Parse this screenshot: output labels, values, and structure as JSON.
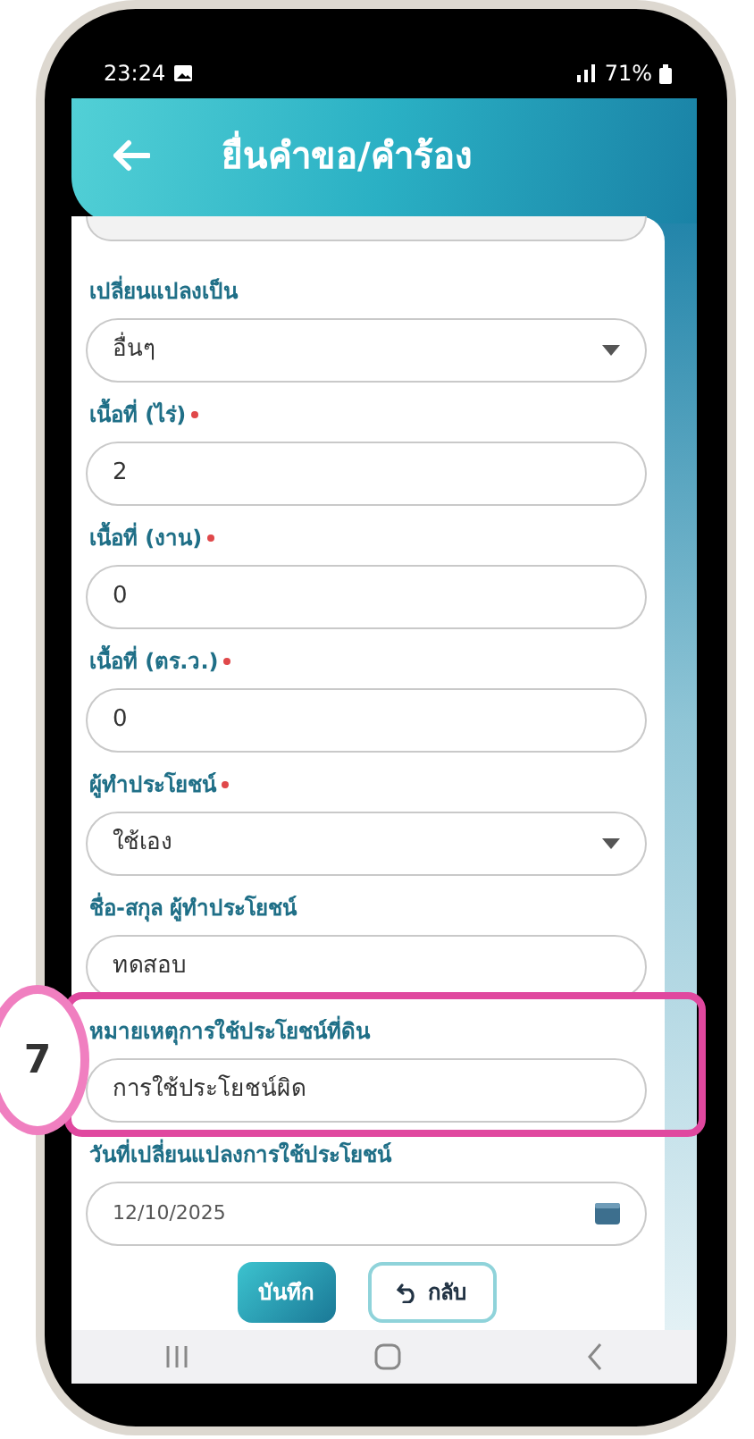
{
  "status_bar": {
    "time": "23:24",
    "battery": "71%"
  },
  "header": {
    "title": "ยื่นคำขอ/คำร้อง"
  },
  "fields": [
    {
      "kind": "select",
      "label": "เปลี่ยนแปลงเป็น",
      "required": false,
      "highlighted": false,
      "value": "อื่นๆ"
    },
    {
      "kind": "text",
      "label": "เนื้อที่ (ไร่)",
      "required": true,
      "highlighted": false,
      "value": "2"
    },
    {
      "kind": "text",
      "label": "เนื้อที่ (งาน)",
      "required": true,
      "highlighted": false,
      "value": "0"
    },
    {
      "kind": "text",
      "label": "เนื้อที่ (ตร.ว.)",
      "required": true,
      "highlighted": false,
      "value": "0"
    },
    {
      "kind": "select",
      "label": "ผู้ทำประโยชน์",
      "required": true,
      "highlighted": false,
      "value": "ใช้เอง"
    },
    {
      "kind": "text",
      "label": "ชื่อ-สกุล ผู้ทำประโยชน์",
      "required": false,
      "highlighted": false,
      "value": "ทดสอบ"
    },
    {
      "kind": "text",
      "label": "หมายเหตุการใช้ประโยชน์ที่ดิน",
      "required": false,
      "highlighted": true,
      "value": "การใช้ประโยชน์ผิด"
    },
    {
      "kind": "date",
      "label": "วันที่เปลี่ยนแปลงการใช้ประโยชน์",
      "required": false,
      "highlighted": false,
      "value": "12/10/2025"
    }
  ],
  "buttons": [
    {
      "kind": "primary",
      "label": "บันทึก"
    },
    {
      "kind": "back",
      "label": "กลับ"
    }
  ],
  "annotation": {
    "number": "7"
  }
}
